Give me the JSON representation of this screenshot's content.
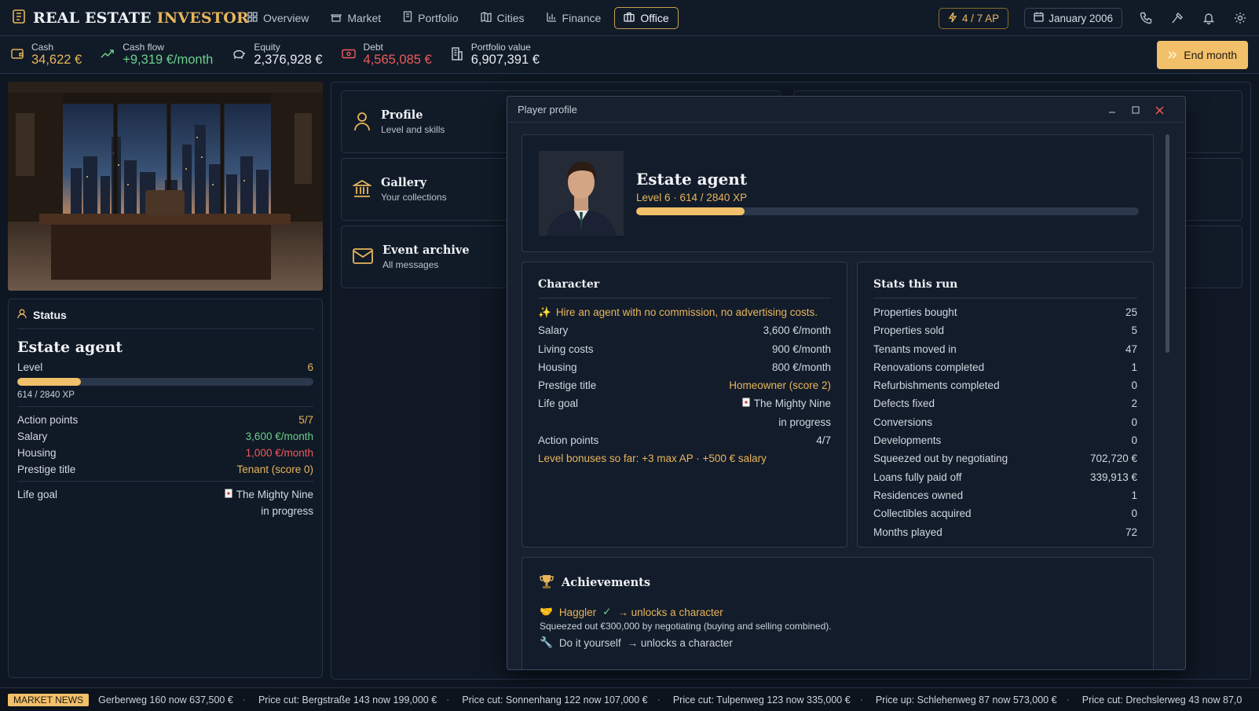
{
  "app": {
    "title_main": "REAL ESTATE",
    "title_accent": "INVESTOR"
  },
  "nav": [
    {
      "label": "Overview",
      "icon": "grid-icon"
    },
    {
      "label": "Market",
      "icon": "shop-icon"
    },
    {
      "label": "Portfolio",
      "icon": "building-icon"
    },
    {
      "label": "Cities",
      "icon": "map-icon"
    },
    {
      "label": "Finance",
      "icon": "bar-chart-icon"
    },
    {
      "label": "Office",
      "icon": "briefcase-icon",
      "active": true
    }
  ],
  "header": {
    "ap": "4 / 7 AP",
    "date": "January 2006"
  },
  "stats": [
    {
      "label": "Cash",
      "value": "34,622 €",
      "tone": "gold"
    },
    {
      "label": "Cash flow",
      "value": "+9,319 €/month",
      "tone": "green"
    },
    {
      "label": "Equity",
      "value": "2,376,928 €",
      "tone": "plain"
    },
    {
      "label": "Debt",
      "value": "4,565,085 €",
      "tone": "red"
    },
    {
      "label": "Portfolio value",
      "value": "6,907,391 €",
      "tone": "plain"
    }
  ],
  "end_month": "End month",
  "status": {
    "heading": "Status",
    "title": "Estate agent",
    "level_label": "Level",
    "level": "6",
    "xp": "614 / 2840 XP",
    "xp_fraction": 0.216,
    "rows": [
      {
        "label": "Action points",
        "value": "5/7",
        "tone": "gold"
      },
      {
        "label": "Salary",
        "value": "3,600 €/month",
        "tone": "green"
      },
      {
        "label": "Housing",
        "value": "1,000 €/month",
        "tone": "red"
      },
      {
        "label": "Prestige title",
        "value": "Tenant (score 0)",
        "tone": "gold"
      }
    ],
    "life_goal_label": "Life goal",
    "life_goal": "The Mighty Nine",
    "life_goal_status": "in progress"
  },
  "cards": [
    {
      "title": "Profile",
      "sub": "Level and skills",
      "icon": "person-icon"
    },
    {
      "title": "Gallery",
      "sub": "Your collections",
      "icon": "museum-icon"
    },
    {
      "title": "Event archive",
      "sub": "All messages",
      "icon": "mail-icon"
    }
  ],
  "modal": {
    "title": "Player profile",
    "profile": {
      "name": "Estate agent",
      "level_line": "Level 6 · 614 / 2840 XP",
      "xp_fraction": 0.216
    },
    "character": {
      "heading": "Character",
      "note": "Hire an agent with no commission, no advertising costs.",
      "rows": [
        {
          "label": "Salary",
          "value": "3,600 €/month"
        },
        {
          "label": "Living costs",
          "value": "900 €/month"
        },
        {
          "label": "Housing",
          "value": "800 €/month"
        },
        {
          "label": "Prestige title",
          "value": "Homeowner (score 2)",
          "tone": "gold"
        },
        {
          "label": "Life goal",
          "value": "The Mighty Nine",
          "value2": "in progress",
          "cardicon": true
        },
        {
          "label": "Action points",
          "value": "4/7"
        }
      ],
      "bonus": "Level bonuses so far: +3 max AP · +500 € salary"
    },
    "stats": {
      "heading": "Stats this run",
      "rows": [
        {
          "label": "Properties bought",
          "value": "25"
        },
        {
          "label": "Properties sold",
          "value": "5"
        },
        {
          "label": "Tenants moved in",
          "value": "47"
        },
        {
          "label": "Renovations completed",
          "value": "1"
        },
        {
          "label": "Refurbishments completed",
          "value": "0"
        },
        {
          "label": "Defects fixed",
          "value": "2"
        },
        {
          "label": "Conversions",
          "value": "0"
        },
        {
          "label": "Developments",
          "value": "0"
        },
        {
          "label": "Squeezed out by negotiating",
          "value": "702,720 €"
        },
        {
          "label": "Loans fully paid off",
          "value": "339,913 €"
        },
        {
          "label": "Residences owned",
          "value": "1"
        },
        {
          "label": "Collectibles acquired",
          "value": "0"
        },
        {
          "label": "Months played",
          "value": "72"
        }
      ]
    },
    "achievements": {
      "heading": "Achievements",
      "items": [
        {
          "name": "Haggler",
          "unlock": "→ unlocks a character",
          "desc": "Squeezed out €300,000 by negotiating (buying and selling combined)."
        },
        {
          "name": "Do it yourself",
          "unlock": "→ unlocks a character"
        }
      ]
    }
  },
  "ticker": {
    "badge": "MARKET NEWS",
    "items": [
      "Gerberweg 160 now 637,500 €",
      "Price cut: Bergstraße 143 now 199,000 €",
      "Price cut: Sonnenhang 122 now 107,000 €",
      "Price cut: Tulpenweg 123 now 335,000 €",
      "Price up: Schlehenweg 87 now 573,000 €",
      "Price cut: Drechslerweg 43 now 87,0"
    ]
  }
}
